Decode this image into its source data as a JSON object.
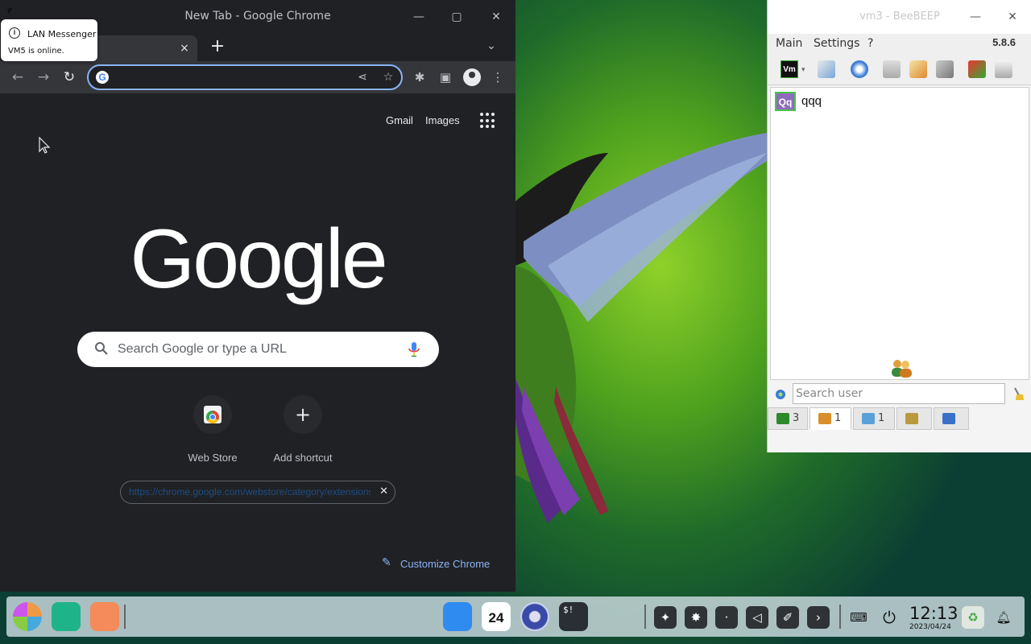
{
  "chrome": {
    "window_title": "New Tab - Google Chrome",
    "tab_close": "×",
    "new_tab": "+",
    "omnibox_value": "",
    "gmail": "Gmail",
    "images": "Images",
    "logo": "Google",
    "search_placeholder": "Search Google or type a URL",
    "shortcuts": [
      {
        "label": "Web Store"
      },
      {
        "label": "Add shortcut"
      }
    ],
    "chip_text": "https://chrome.google.com/webstore/category/extensions",
    "customize": "Customize Chrome"
  },
  "notification": {
    "title": "LAN Messenger",
    "message": "VM5 is online."
  },
  "beebeep": {
    "window_title": "vm3 - BeeBEEP",
    "menu": [
      "Main",
      "Settings",
      "?"
    ],
    "version": "5.8.6",
    "vm_label": "Vm",
    "users": [
      {
        "avatar": "Qq",
        "name": "qqq"
      }
    ],
    "search_placeholder": "Search user",
    "tabs": [
      {
        "count": "3"
      },
      {
        "count": "1"
      },
      {
        "count": "1"
      },
      {
        "count": ""
      },
      {
        "count": ""
      }
    ]
  },
  "taskbar": {
    "calendar_day": "24",
    "terminal_label": "$!",
    "time": "12:13",
    "date": "2023/04/24"
  }
}
